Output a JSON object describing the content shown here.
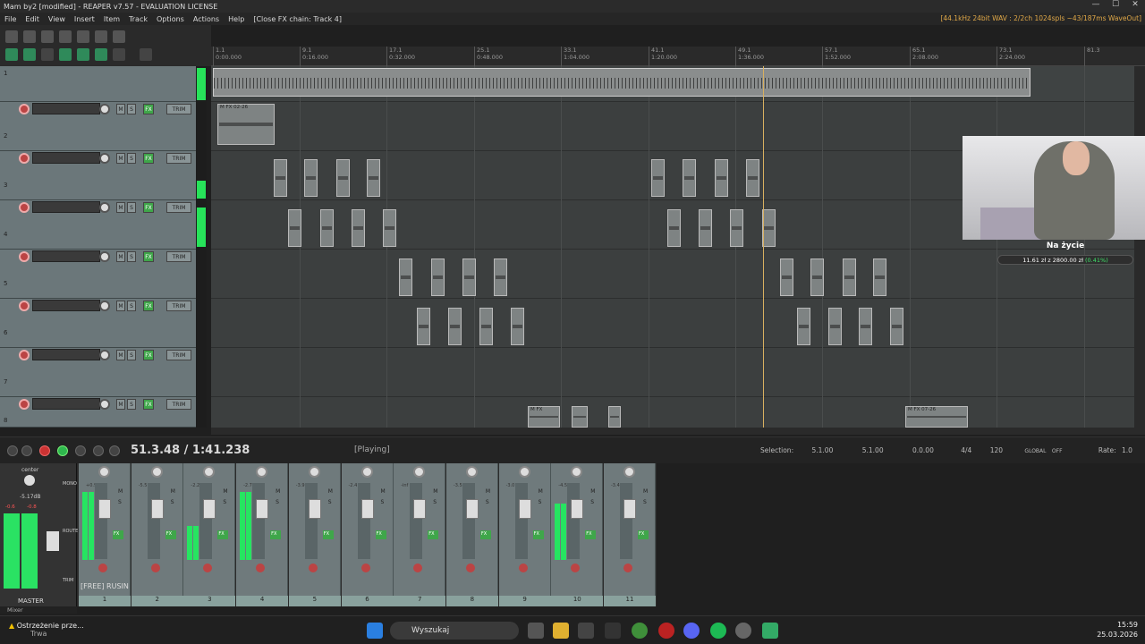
{
  "window": {
    "title": "Mam by2 [modified] - REAPER v7.57 - EVALUATION LICENSE"
  },
  "menu": {
    "items": [
      "File",
      "Edit",
      "View",
      "Insert",
      "Item",
      "Track",
      "Options",
      "Actions",
      "Help",
      "[Close FX chain: Track 4]"
    ],
    "status": "[44.1kHz 24bit WAV : 2/2ch 1024spls ~43/187ms WaveOut]"
  },
  "ruler": {
    "ticks": [
      "1.1\n0:00.000",
      "9.1\n0:16.000",
      "17.1\n0:32.000",
      "25.1\n0:48.000",
      "33.1\n1:04.000",
      "41.1\n1:20.000",
      "49.1\n1:36.000",
      "57.1\n1:52.000",
      "65.1\n2:08.000",
      "73.1\n2:24.000",
      "81.3"
    ]
  },
  "tracks": [
    {
      "num": "1"
    },
    {
      "num": "2"
    },
    {
      "num": "3"
    },
    {
      "num": "4"
    },
    {
      "num": "5"
    },
    {
      "num": "6"
    },
    {
      "num": "7"
    },
    {
      "num": "8"
    }
  ],
  "track_buttons": {
    "m": "M",
    "s": "S",
    "fx": "FX",
    "trim": "TRIM"
  },
  "items": {
    "first_label": "M FX 02-26",
    "last_label": "M FX 07-26",
    "late_label": "M FX"
  },
  "transport": {
    "position": "51.3.48 / 1:41.238",
    "state": "[Playing]",
    "selection_label": "Selection:",
    "sel_start": "5.1.00",
    "sel_end": "5.1.00",
    "sel_len": "0.0.00",
    "timesig": "4/4",
    "bpm": "120",
    "rate_label": "Rate:",
    "rate": "1.0",
    "global": "GLOBAL",
    "off": "OFF"
  },
  "mixer": {
    "master": {
      "label": "MASTER",
      "pan": "center",
      "db": "-5.17dB",
      "peak": "-0.6",
      "peak2": "-0.8",
      "mono": "MONO",
      "route": "ROUTE",
      "trim": "TRIM"
    },
    "track_name": "[FREE] RUSIN",
    "strips": [
      {
        "num": "1",
        "db": "+0.9",
        "m": "M",
        "s": "S",
        "fx": "FX",
        "level": 0.9
      },
      {
        "num": "2",
        "db": "-5.5",
        "m": "M",
        "s": "S",
        "fx": "FX",
        "level": 0.0
      },
      {
        "num": "3",
        "db": "-2.2",
        "m": "M",
        "s": "S",
        "fx": "FX",
        "level": 0.45
      },
      {
        "num": "4",
        "db": "-2.7",
        "m": "M",
        "s": "S",
        "fx": "FX",
        "level": 0.9
      },
      {
        "num": "5",
        "db": "-3.9",
        "m": "M",
        "s": "S",
        "fx": "FX",
        "level": 0.0
      },
      {
        "num": "6",
        "db": "-2.4",
        "m": "M",
        "s": "S",
        "fx": "FX",
        "level": 0.0
      },
      {
        "num": "7",
        "db": "-inf",
        "m": "M",
        "s": "S",
        "fx": "FX",
        "level": 0.0
      },
      {
        "num": "8",
        "db": "-3.5",
        "m": "M",
        "s": "S",
        "fx": "FX",
        "level": 0.0
      },
      {
        "num": "9",
        "db": "-3.0",
        "m": "M",
        "s": "S",
        "fx": "FX",
        "level": 0.0
      },
      {
        "num": "10",
        "db": "-4.5",
        "m": "M",
        "s": "S",
        "fx": "FX",
        "level": 0.75
      },
      {
        "num": "11",
        "db": "-3.4",
        "m": "M",
        "s": "S",
        "fx": "FX",
        "level": 0.0
      }
    ],
    "tab": "Mixer"
  },
  "overlay": {
    "title": "Na życie",
    "amount": "11.61 zł z 2800.00 zł",
    "percent": "(0.41%)",
    "progress": 0.0041
  },
  "taskbar": {
    "warn_title": "Ostrzeżenie prze...",
    "warn_sub": "Trwa",
    "search": "Wyszukaj",
    "time": "15:59",
    "date": "25.03.2026"
  },
  "colors": {
    "accent_green": "#27e35a",
    "record_red": "#b44444",
    "playhead": "#d8b060",
    "track_bg": "#6b777a"
  }
}
